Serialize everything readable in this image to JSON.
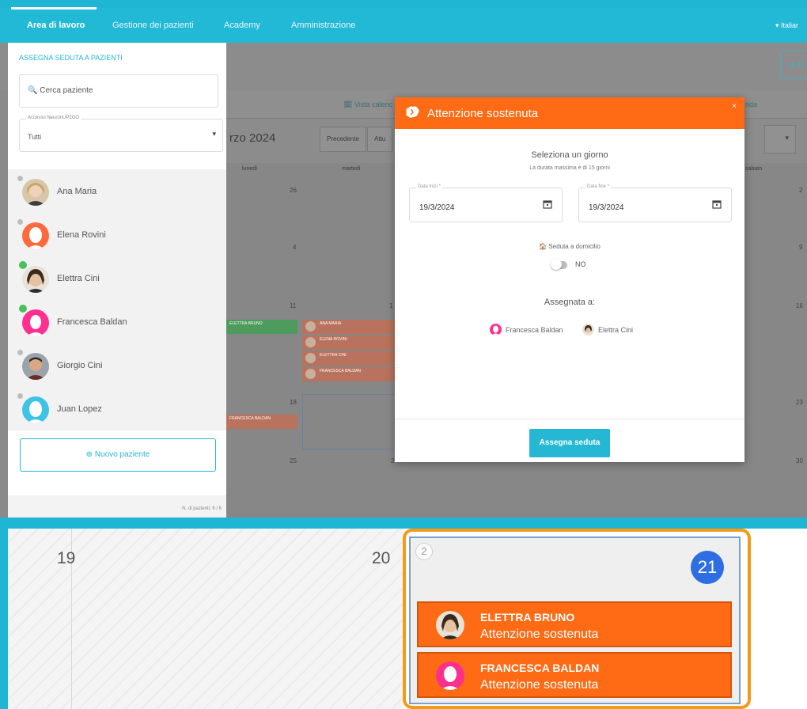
{
  "nav": {
    "items": [
      {
        "label": "Area di lavoro"
      },
      {
        "label": "Gestione dei pazienti"
      },
      {
        "label": "Academy"
      },
      {
        "label": "Amministrazione"
      }
    ],
    "language": "▾  Italiar"
  },
  "calendar": {
    "new_button": "⊕ N",
    "tabs": [
      {
        "label": "🗓 Vista calenc"
      },
      {
        "label": "nda"
      }
    ],
    "month_label": "rzo 2024",
    "buttons": [
      {
        "label": "Precedente"
      },
      {
        "label": "Attu"
      }
    ],
    "select_caret": "▾",
    "weekdays": [
      "lunedì",
      "martedì",
      "sabato"
    ],
    "day_numbers": [
      "26",
      "2",
      "4",
      "9",
      "11",
      "1",
      "16",
      "18",
      "23",
      "25",
      "2",
      "30"
    ],
    "events_left": [
      {
        "title": "ELETTRA BRUNO",
        "subtitle": "Attenzione sostenuta"
      },
      {
        "title": "FRANCESCA BALDAN",
        "subtitle": "Attenzione sostenuta"
      }
    ],
    "events_tue": [
      {
        "title": "ANA MARIA",
        "subtitle": "Attenzione sostenuta"
      },
      {
        "title": "ELENA ROVINI",
        "subtitle": "Attenzione sostenuta"
      },
      {
        "title": "ELETTRA CINI",
        "subtitle": "Attenzione sostenuta"
      },
      {
        "title": "FRANCESCA BALDAN",
        "subtitle": "Attenzione sostenuta"
      }
    ]
  },
  "sidebar": {
    "title": "ASSEGNA SEDUTA A PAZIENTI",
    "search_placeholder": "🔍 Cerca paziente",
    "filter_label": "Accesso NeuronUP2GO",
    "filter_value": "Tutti",
    "filter_caret": "▾",
    "patients": [
      {
        "name": "Ana Maria",
        "online": false,
        "avatar": "photo-avatar"
      },
      {
        "name": "Elena Rovini",
        "online": false,
        "avatar": "orange-avatar"
      },
      {
        "name": "Elettra Cini",
        "online": true,
        "avatar": "photo-avatar"
      },
      {
        "name": "Francesca Baldan",
        "online": true,
        "avatar": "pink-avatar"
      },
      {
        "name": "Giorgio Cini",
        "online": false,
        "avatar": "photo-avatar"
      },
      {
        "name": "Juan Lopez",
        "online": false,
        "avatar": "cyan-avatar"
      }
    ],
    "new_patient": "⊕  Nuovo paziente",
    "count": "N. di pazienti: 6 / 6"
  },
  "modal": {
    "title": "Attenzione sostenuta",
    "close": "×",
    "select_day": "Seleziona un giorno",
    "max_duration": "La durata massima è di 15 giorni",
    "start_label": "Data Inizi *",
    "start_value": "19/3/2024",
    "end_label": "Data fine *",
    "end_value": "19/3/2024",
    "home_session": "🏠 Seduta a domicilio",
    "toggle_value": "NO",
    "assigned_to": "Assegnata a:",
    "assignees": [
      "Francesca Baldan",
      "Elettra Cini"
    ],
    "assign_button": "Assegna seduta"
  },
  "zoom": {
    "day_left": "19",
    "day_mid": "20",
    "more_count": "2",
    "today": "21",
    "events": [
      {
        "title": "ELETTRA BRUNO",
        "subtitle": "Attenzione sostenuta"
      },
      {
        "title": "FRANCESCA BALDAN",
        "subtitle": "Attenzione sostenuta"
      }
    ]
  },
  "colors": {
    "brand_cyan": "#1fb6d3",
    "modal_orange": "#ff6a14",
    "online_green": "#49c05a",
    "today_blue": "#2e6de2",
    "highlight_orange": "#f59a16"
  }
}
